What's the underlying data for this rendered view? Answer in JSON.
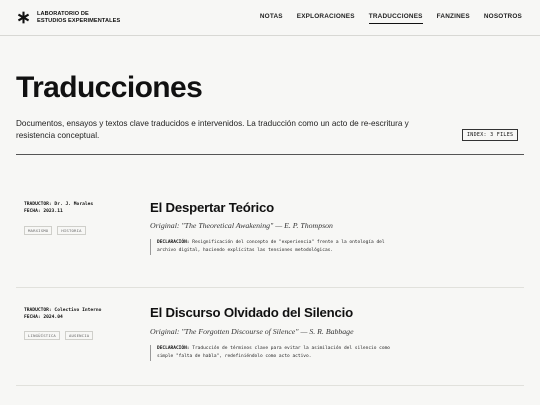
{
  "brand": {
    "line1": "LABORATORIO DE",
    "line2": "ESTUDIOS EXPERIMENTALES"
  },
  "nav": [
    {
      "label": "NOTAS",
      "active": false
    },
    {
      "label": "EXPLORACIONES",
      "active": false
    },
    {
      "label": "TRADUCCIONES",
      "active": true
    },
    {
      "label": "FANZINES",
      "active": false
    },
    {
      "label": "NOSOTROS",
      "active": false
    }
  ],
  "hero": {
    "title": "Traducciones",
    "description": "Documentos, ensayos y textos clave traducidos e intervenidos. La traducción como un acto de re-escritura y resistencia conceptual.",
    "index_label": "INDEX: 3 FILES"
  },
  "entries": [
    {
      "translator": "TRADUCTOR: Dr. J. Morales",
      "date": "FECHA: 2023.11",
      "tags": [
        "MARXISMO",
        "HISTORIA"
      ],
      "title": "El Despertar Teórico",
      "original": "Original: \"The Theoretical Awakening\" — E. P. Thompson",
      "note_label": "DECLARACIÓN:",
      "note_text": "Resignificación del concepto de \"experiencia\" frente a la ontología del archivo digital, haciendo explícitas las tensiones metodológicas."
    },
    {
      "translator": "TRADUCTOR: Colectivo Interno",
      "date": "FECHA: 2024.04",
      "tags": [
        "LINGÜÍSTICA",
        "AUSENCIA"
      ],
      "title": "El Discurso Olvidado del Silencio",
      "original": "Original: \"The Forgotten Discourse of Silence\" — S. R. Babbage",
      "note_label": "DECLARACIÓN:",
      "note_text": "Traducción de términos clave para evitar la asimilación del silencio como simple \"falta de habla\", redefiniéndolo como acto activo."
    }
  ],
  "icons": {
    "logo": "asterisk-logo-icon"
  }
}
